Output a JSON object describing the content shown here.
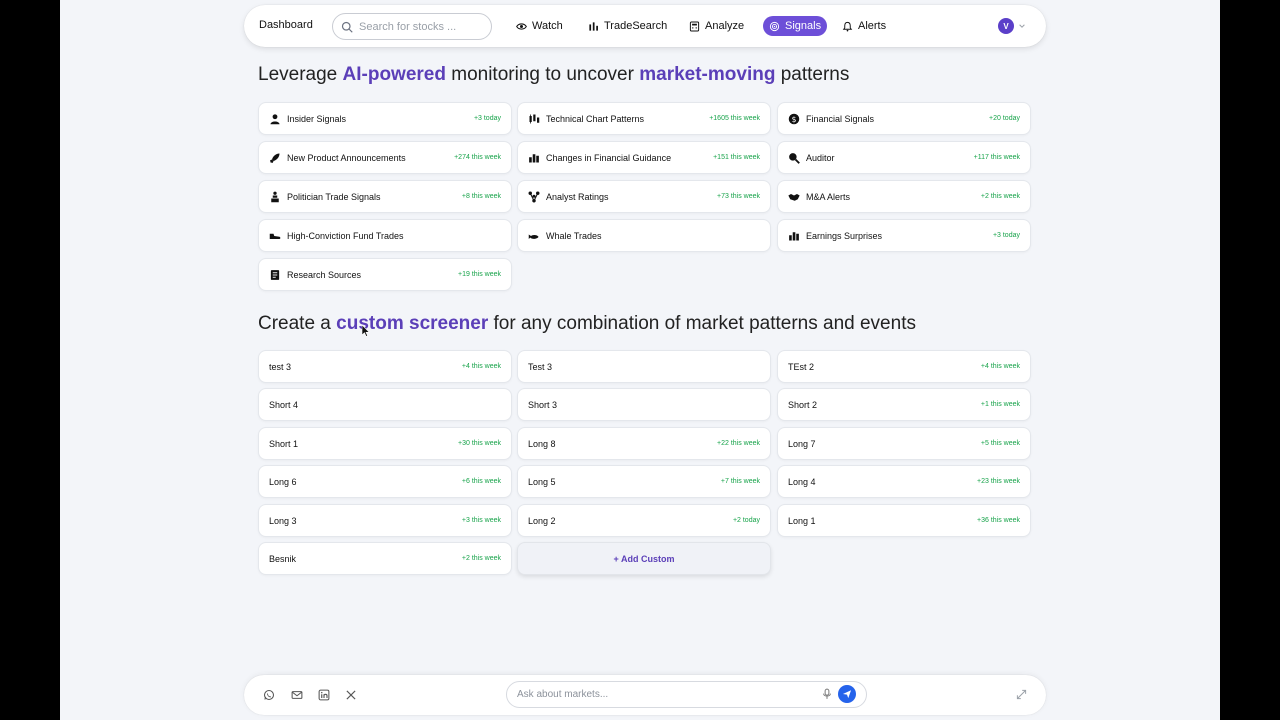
{
  "nav": {
    "brand": "Dashboard",
    "search_placeholder": "Search for stocks ...",
    "items": [
      {
        "label": "Watch",
        "icon": "eye-icon"
      },
      {
        "label": "TradeSearch",
        "icon": "bars-icon"
      },
      {
        "label": "Analyze",
        "icon": "calculator-icon"
      },
      {
        "label": "Signals",
        "icon": "radar-icon",
        "active": true
      },
      {
        "label": "Alerts",
        "icon": "bell-icon"
      }
    ],
    "avatar_initial": "V"
  },
  "section1": {
    "prefix": "Leverage ",
    "hl1": "AI-powered",
    "mid": " monitoring to uncover ",
    "hl2": "market-moving",
    "suffix": " patterns"
  },
  "signals": [
    {
      "label": "Insider Signals",
      "badge": "+3 today",
      "icon": "person-icon"
    },
    {
      "label": "Technical Chart Patterns",
      "badge": "+1605 this week",
      "icon": "candlestick-icon"
    },
    {
      "label": "Financial Signals",
      "badge": "+20 today",
      "icon": "dollar-icon"
    },
    {
      "label": "New Product Announcements",
      "badge": "+274 this week",
      "icon": "rocket-icon"
    },
    {
      "label": "Changes in Financial Guidance",
      "badge": "+151 this week",
      "icon": "bar-chart-icon"
    },
    {
      "label": "Auditor",
      "badge": "+117 this week",
      "icon": "magnifier-icon"
    },
    {
      "label": "Politician Trade Signals",
      "badge": "+8 this week",
      "icon": "podium-icon"
    },
    {
      "label": "Analyst Ratings",
      "badge": "+73 this week",
      "icon": "network-icon"
    },
    {
      "label": "M&A Alerts",
      "badge": "+2 this week",
      "icon": "handshake-icon"
    },
    {
      "label": "High-Conviction Fund Trades",
      "badge": "",
      "icon": "shoe-icon"
    },
    {
      "label": "Whale Trades",
      "badge": "",
      "icon": "whale-icon"
    },
    {
      "label": "Earnings Surprises",
      "badge": "+3 today",
      "icon": "bar-chart-icon"
    },
    {
      "label": "Research Sources",
      "badge": "+19 this week",
      "icon": "document-icon"
    }
  ],
  "section2": {
    "prefix": "Create a ",
    "hl1": "custom screener",
    "suffix": " for any combination of market patterns and events"
  },
  "screeners": [
    {
      "label": "test 3",
      "badge": "+4 this week"
    },
    {
      "label": "Test 3",
      "badge": ""
    },
    {
      "label": "TEst 2",
      "badge": "+4 this week"
    },
    {
      "label": "Short 4",
      "badge": ""
    },
    {
      "label": "Short 3",
      "badge": ""
    },
    {
      "label": "Short 2",
      "badge": "+1 this week"
    },
    {
      "label": "Short 1",
      "badge": "+30 this week"
    },
    {
      "label": "Long 8",
      "badge": "+22 this week"
    },
    {
      "label": "Long 7",
      "badge": "+5 this week"
    },
    {
      "label": "Long 6",
      "badge": "+6 this week"
    },
    {
      "label": "Long 5",
      "badge": "+7 this week"
    },
    {
      "label": "Long 4",
      "badge": "+23 this week"
    },
    {
      "label": "Long 3",
      "badge": "+3 this week"
    },
    {
      "label": "Long 2",
      "badge": "+2 today"
    },
    {
      "label": "Long 1",
      "badge": "+36 this week"
    },
    {
      "label": "Besnik",
      "badge": "+2 this week"
    }
  ],
  "add_custom_label": "+ Add Custom",
  "bottom": {
    "ask_placeholder": "Ask about markets...",
    "socials": [
      "whatsapp-icon",
      "mail-icon",
      "linkedin-icon",
      "x-icon"
    ]
  },
  "colors": {
    "accent": "#6d4fd8",
    "highlight": "#5b3fb8",
    "badge_green": "#17a34a",
    "send_blue": "#2563eb"
  }
}
